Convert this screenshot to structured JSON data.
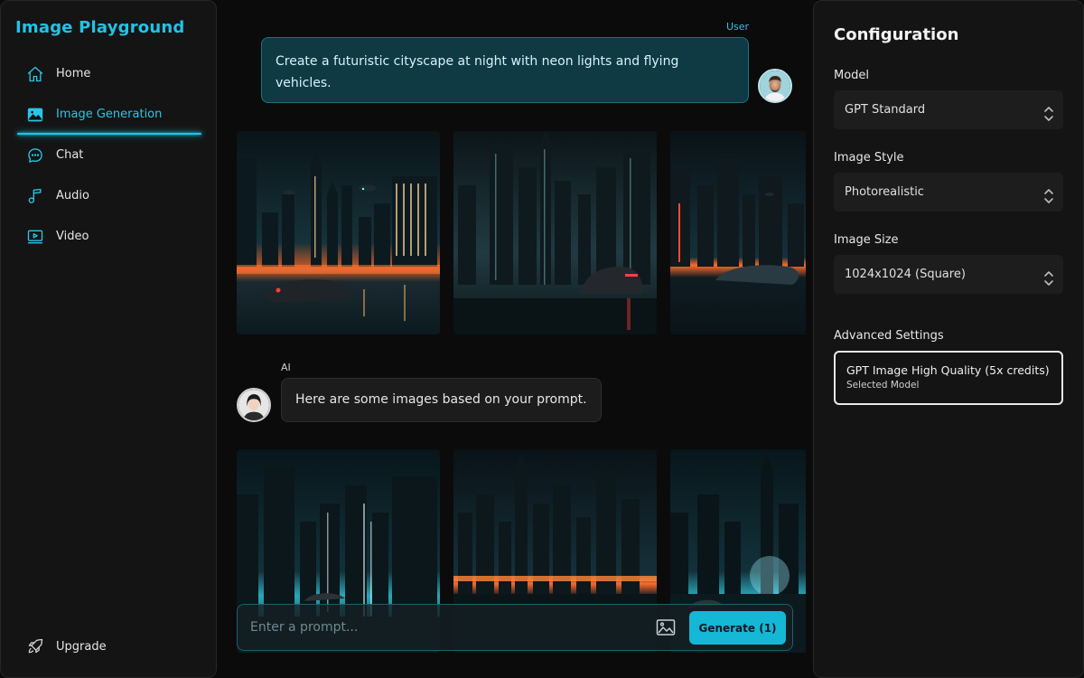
{
  "app": {
    "title": "Image Playground"
  },
  "sidebar": {
    "items": [
      {
        "label": "Home",
        "icon": "home-icon"
      },
      {
        "label": "Image Generation",
        "icon": "image-icon",
        "active": true
      },
      {
        "label": "Chat",
        "icon": "chat-bubble-icon"
      },
      {
        "label": "Audio",
        "icon": "music-note-icon"
      },
      {
        "label": "Video",
        "icon": "video-icon"
      }
    ],
    "upgrade": {
      "label": "Upgrade",
      "icon": "rocket-icon"
    }
  },
  "chat": {
    "user": {
      "label": "User",
      "message": "Create a futuristic cityscape at night with neon lights and flying vehicles."
    },
    "ai": {
      "label": "AI",
      "message": "Here are some images based on your prompt."
    },
    "prompt": {
      "placeholder": "Enter a prompt...",
      "generate_label": "Generate (1)"
    }
  },
  "config": {
    "title": "Configuration",
    "model": {
      "label": "Model",
      "value": "GPT Standard"
    },
    "style": {
      "label": "Image Style",
      "value": "Photorealistic"
    },
    "size": {
      "label": "Image Size",
      "value": "1024x1024 (Square)"
    },
    "advanced": {
      "label": "Advanced Settings",
      "value": "GPT Image High Quality (5x credits)",
      "sub": "Selected Model"
    }
  },
  "colors": {
    "accent": "#22c3e6",
    "user_bubble": "#0f3a44",
    "generate_button": "#15b7d7"
  }
}
